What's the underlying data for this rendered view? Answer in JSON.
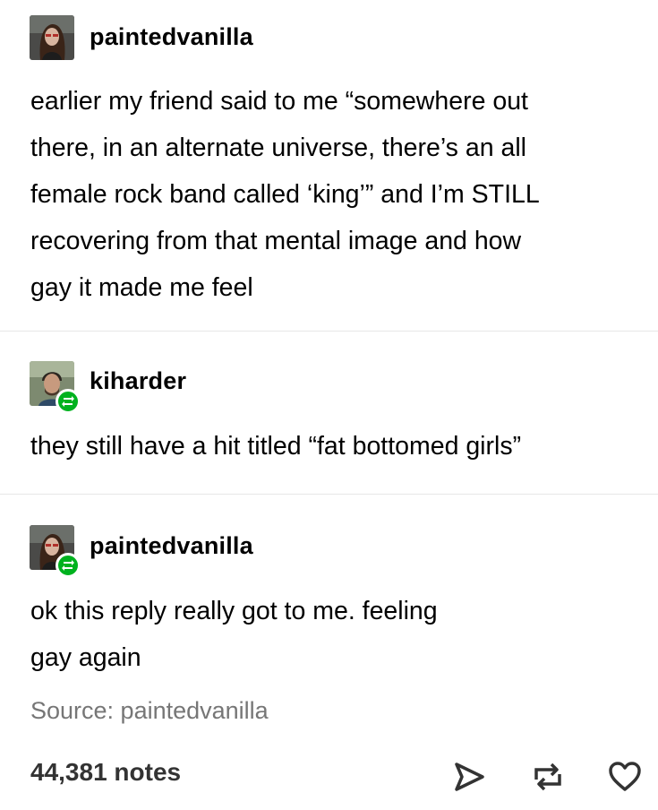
{
  "posts": [
    {
      "username": "paintedvanilla",
      "avatar": "avatar-paintedvanilla",
      "reblogged": false,
      "lines": [
        "earlier my friend said to me “somewhere out",
        "there, in an alternate universe, there’s an all",
        "female rock band called ‘king’” and I’m STILL",
        "recovering from that mental image and how",
        "gay it made me feel"
      ]
    },
    {
      "username": "kiharder",
      "avatar": "avatar-kiharder",
      "reblogged": true,
      "lines": [
        "they still have a hit titled “fat bottomed girls”"
      ]
    },
    {
      "username": "paintedvanilla",
      "avatar": "avatar-paintedvanilla",
      "reblogged": true,
      "lines": [
        "ok this reply really got to me. feeling",
        "gay again"
      ]
    }
  ],
  "source": "Source: paintedvanilla",
  "footer": {
    "notes": "44,381 notes",
    "actions": [
      "share-icon",
      "reblog-icon",
      "like-icon"
    ]
  },
  "colors": {
    "reblog_badge": "#00b21f",
    "source_text": "#767676",
    "divider": "#e7e7e7"
  }
}
